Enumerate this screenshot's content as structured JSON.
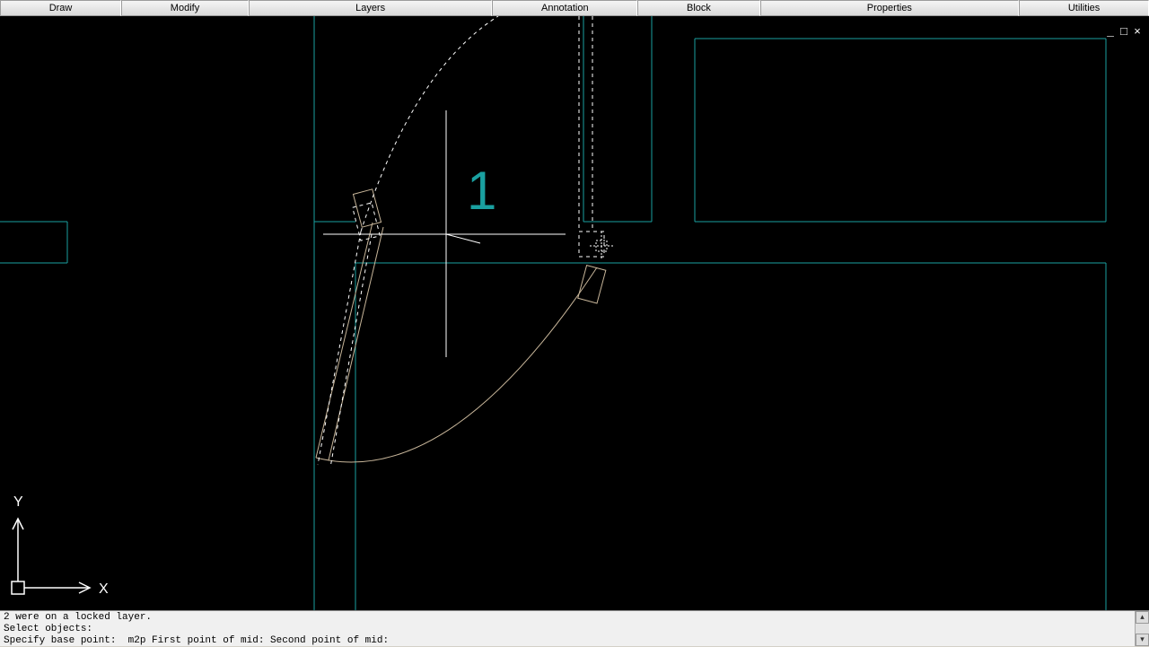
{
  "ribbon": {
    "tabs": [
      {
        "label": "Draw",
        "wide": false
      },
      {
        "label": "Modify",
        "wide": false
      },
      {
        "label": "Layers",
        "wide": true
      },
      {
        "label": "Annotation",
        "wide": false
      },
      {
        "label": "Block",
        "wide": false
      },
      {
        "label": "Properties",
        "wide": true
      },
      {
        "label": "Utilities",
        "wide": false
      }
    ]
  },
  "marker_label": "1",
  "ucs": {
    "x": "X",
    "y": "Y"
  },
  "window_controls": {
    "min": "_",
    "max": "□",
    "close": "×"
  },
  "scroll": {
    "up": "▴",
    "down": "▾"
  },
  "command": {
    "line1": "2 were on a locked layer.",
    "line2": "Select objects:",
    "line3": "Specify base point:  m2p First point of mid: Second point of mid:"
  },
  "colors": {
    "teal": "#1aa0a0",
    "tan": "#c8b69a",
    "white": "#ffffff"
  }
}
